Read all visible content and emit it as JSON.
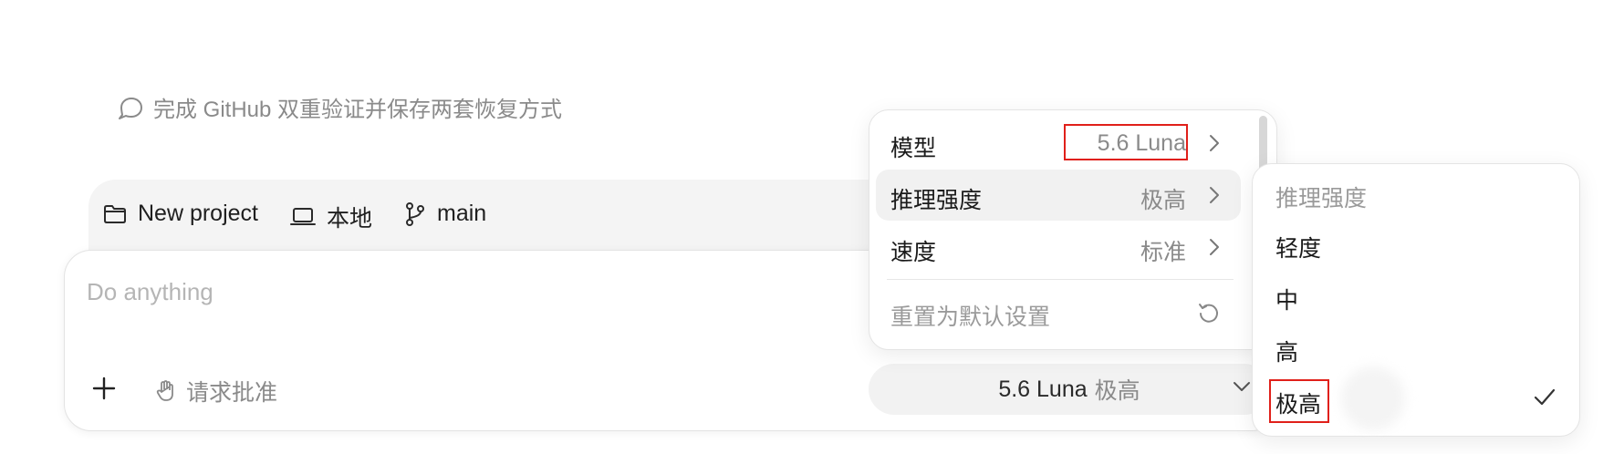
{
  "suggestion": {
    "text": "完成 GitHub 双重验证并保存两套恢复方式",
    "icon": "chat-bubble-icon"
  },
  "project_bar": {
    "project": {
      "label": "New project",
      "icon": "folder-icon"
    },
    "location": {
      "label": "本地",
      "icon": "laptop-icon"
    },
    "branch": {
      "label": "main",
      "icon": "git-branch-icon"
    }
  },
  "composer": {
    "placeholder": "Do anything",
    "add_icon": "plus-icon",
    "approval": {
      "label": "请求批准",
      "icon": "hand-icon"
    },
    "model_pill": {
      "model": "5.6 Luna",
      "effort": "极高",
      "icon": "chevron-down-icon"
    }
  },
  "settings_menu": {
    "rows": [
      {
        "label": "模型",
        "value": "5.6 Luna"
      },
      {
        "label": "推理强度",
        "value": "极高"
      },
      {
        "label": "速度",
        "value": "标准"
      }
    ],
    "reset_label": "重置为默认设置",
    "reset_icon": "reset-icon"
  },
  "effort_menu": {
    "header": "推理强度",
    "options": [
      "轻度",
      "中",
      "高",
      "极高"
    ],
    "selected": "极高",
    "check_icon": "check-icon"
  },
  "colors": {
    "highlight_border": "#e0201a",
    "muted_text": "#8a8a8a"
  }
}
